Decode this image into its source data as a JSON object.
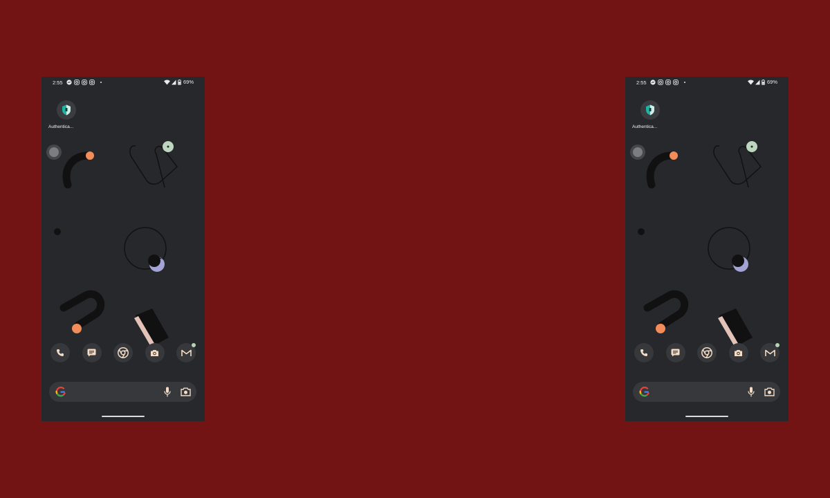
{
  "status_bar": {
    "time": "2:55",
    "battery": "69%",
    "notification_icons": [
      "messenger-icon",
      "instagram-icon",
      "instagram-icon",
      "instagram-icon"
    ]
  },
  "home": {
    "apps": [
      {
        "label": "Authentica...",
        "icon": "authenticator-shield-icon"
      }
    ]
  },
  "dock": {
    "apps": [
      {
        "icon": "phone-icon"
      },
      {
        "icon": "messages-icon"
      },
      {
        "icon": "chrome-icon"
      },
      {
        "icon": "camera-icon"
      },
      {
        "icon": "gmail-icon",
        "badge": true
      }
    ]
  },
  "search": {
    "icons": [
      "google-logo-icon",
      "mic-icon",
      "lens-icon"
    ]
  },
  "colors": {
    "background": "#721314",
    "phone_screen": "#27282b",
    "accent_orange": "#f28c59",
    "accent_lavender": "#a3a3d6",
    "accent_mint": "#bcd6bf",
    "icon_cream": "#f4dcc6"
  }
}
